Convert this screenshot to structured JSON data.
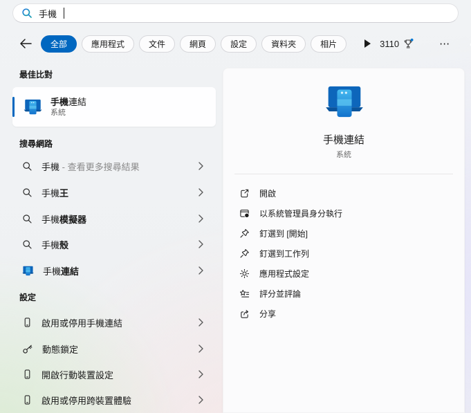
{
  "colors": {
    "accent": "#0067c0",
    "rewards_dot": "#0078d4"
  },
  "search": {
    "query": "手機"
  },
  "filters": {
    "tabs": [
      {
        "label": "全部",
        "selected": true
      },
      {
        "label": "應用程式",
        "selected": false
      },
      {
        "label": "文件",
        "selected": false
      },
      {
        "label": "網頁",
        "selected": false
      },
      {
        "label": "設定",
        "selected": false
      },
      {
        "label": "資料夾",
        "selected": false
      },
      {
        "label": "相片",
        "selected": false
      }
    ],
    "rewards_points": "3110",
    "more_label": "⋯"
  },
  "best_match": {
    "header": "最佳比對",
    "item": {
      "title_match": "手機",
      "title_rest": "連結",
      "subtitle": "系統"
    }
  },
  "web": {
    "header": "搜尋網路",
    "items": [
      {
        "match": "手機",
        "rest": "",
        "note": " - 查看更多搜尋結果",
        "icon": "search"
      },
      {
        "match": "手機",
        "rest": "王",
        "note": "",
        "icon": "search"
      },
      {
        "match": "手機",
        "rest": "模擬器",
        "note": "",
        "icon": "search"
      },
      {
        "match": "手機",
        "rest": "殼",
        "note": "",
        "icon": "search"
      },
      {
        "match": "手機",
        "rest": "連結",
        "note": "",
        "icon": "phone-link-app"
      }
    ]
  },
  "settings": {
    "header": "設定",
    "items": [
      {
        "label": "啟用或停用手機連結",
        "icon": "smartphone"
      },
      {
        "label": "動態鎖定",
        "icon": "key"
      },
      {
        "label": "開啟行動裝置設定",
        "icon": "smartphone"
      },
      {
        "label": "啟用或停用跨裝置體驗",
        "icon": "smartphone"
      }
    ]
  },
  "panel": {
    "title": "手機連結",
    "subtitle": "系統",
    "actions": [
      {
        "label": "開啟",
        "icon": "open-external"
      },
      {
        "label": "以系統管理員身分執行",
        "icon": "run-as-admin"
      },
      {
        "label": "釘選到 [開始]",
        "icon": "pin"
      },
      {
        "label": "釘選到工作列",
        "icon": "pin"
      },
      {
        "label": "應用程式設定",
        "icon": "gear"
      },
      {
        "label": "評分並評論",
        "icon": "rate-review"
      },
      {
        "label": "分享",
        "icon": "share"
      }
    ]
  }
}
